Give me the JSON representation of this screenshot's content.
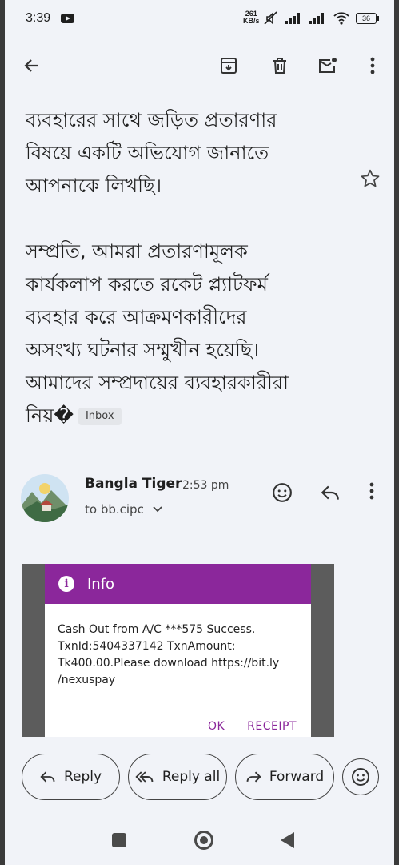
{
  "status_bar": {
    "time": "3:39",
    "net_speed_value": "261",
    "net_speed_unit": "KB/s",
    "battery": "36"
  },
  "email": {
    "body_lines": [
      "ব্যবহারের সাথে জড়িত প্রতারণার",
      "বিষয়ে একটি অভিযোগ জানাতে",
      "আপনাকে লিখছি।"
    ],
    "body_lines_2": [
      "সম্প্রতি, আমরা প্রতারণামূলক",
      "কার্যকলাপ করতে রকেট প্ল্যাটফর্ম",
      "ব্যবহার করে আক্রমণকারীদের",
      "অসংখ্য ঘটনার সম্মুখীন হয়েছি।",
      "আমাদের সম্প্রদায়ের ব্যবহারকারীরা"
    ],
    "last_line": "নিয়�",
    "label_chip": "Inbox"
  },
  "sender": {
    "name": "Bangla Tiger",
    "time": "2:53 pm",
    "to": "to bb.cipc"
  },
  "attachment": {
    "dialog_title": "Info",
    "dialog_icon": "i",
    "message_lines": [
      "Cash Out from A/C ***575 Success.",
      "TxnId:5404337142 TxnAmount:",
      "Tk400.00.Please download https://bit.ly",
      "/nexuspay"
    ],
    "btn_ok": "OK",
    "btn_receipt": "RECEIPT",
    "accent_color": "#8b279b"
  },
  "actions": {
    "reply": "Reply",
    "reply_all": "Reply all",
    "forward": "Forward"
  }
}
